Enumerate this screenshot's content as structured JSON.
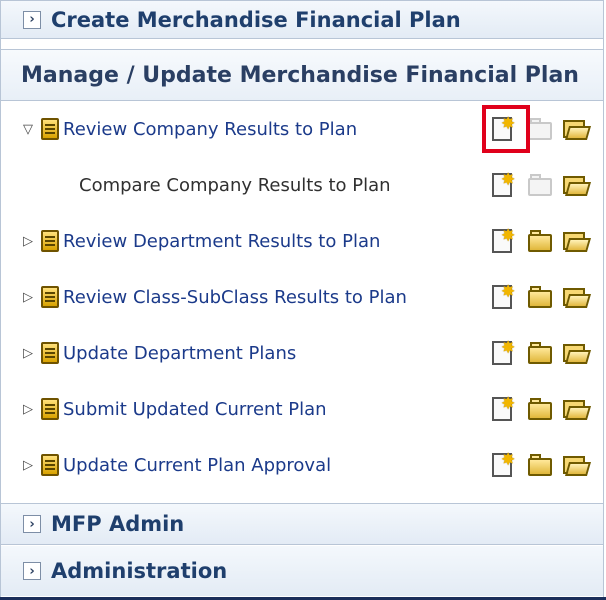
{
  "sections": {
    "create": {
      "label": "Create Merchandise Financial Plan",
      "toggle": "›"
    },
    "manage": {
      "label": "Manage / Update Merchandise Financial Plan"
    },
    "mfp_admin": {
      "label": "MFP Admin",
      "toggle": "›"
    },
    "administration": {
      "label": "Administration",
      "toggle": "›"
    }
  },
  "tasks": [
    {
      "label": "Review Company Results to Plan",
      "expander": "▽",
      "expanded": true,
      "has_doc_icon": true,
      "open_disabled": true
    },
    {
      "label": "Compare Company Results to Plan",
      "expander": "",
      "child": true,
      "has_doc_icon": false,
      "open_disabled": true
    },
    {
      "label": "Review Department Results to Plan",
      "expander": "▷",
      "has_doc_icon": true,
      "open_disabled": false
    },
    {
      "label": "Review Class-SubClass Results to Plan",
      "expander": "▷",
      "has_doc_icon": true,
      "open_disabled": false
    },
    {
      "label": "Update Department Plans",
      "expander": "▷",
      "has_doc_icon": true,
      "open_disabled": false
    },
    {
      "label": "Submit Updated Current Plan",
      "expander": "▷",
      "has_doc_icon": true,
      "open_disabled": false
    },
    {
      "label": "Update Current Plan Approval",
      "expander": "▷",
      "has_doc_icon": true,
      "open_disabled": false
    }
  ],
  "icons": {
    "create_new": "new-document-icon",
    "open": "folder-icon",
    "open_existing": "open-folder-icon",
    "task_doc": "task-document-icon"
  },
  "highlight": {
    "color": "#e0001b",
    "target": "create-new-workbook-review-company"
  }
}
